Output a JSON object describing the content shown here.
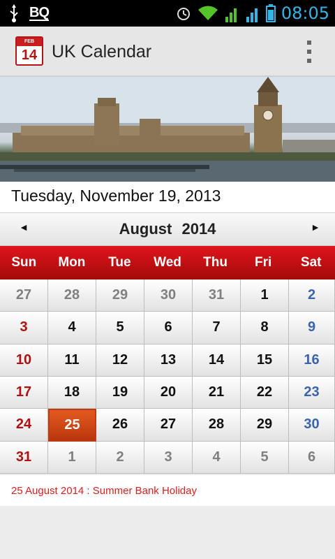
{
  "status_bar": {
    "time": "08:05",
    "left_label": "BQ",
    "icons": [
      "usb-icon",
      "bq-icon",
      "alarm-icon",
      "wifi-icon",
      "signal-1x-icon",
      "signal-r-icon",
      "battery-charging-icon"
    ]
  },
  "action_bar": {
    "title": "UK Calendar",
    "app_icon_month": "FEB",
    "app_icon_day": "14",
    "menu_icon": "overflow-menu-icon"
  },
  "today": {
    "label": "Tuesday, November 19, 2013"
  },
  "month_nav": {
    "month": "August",
    "year": "2014",
    "prev_icon": "◄",
    "next_icon": "►"
  },
  "weekdays": [
    "Sun",
    "Mon",
    "Tue",
    "Wed",
    "Thu",
    "Fri",
    "Sat"
  ],
  "calendar": {
    "rows": [
      [
        {
          "d": "27",
          "t": "other"
        },
        {
          "d": "28",
          "t": "other"
        },
        {
          "d": "29",
          "t": "other"
        },
        {
          "d": "30",
          "t": "other"
        },
        {
          "d": "31",
          "t": "other"
        },
        {
          "d": "1",
          "t": "cur"
        },
        {
          "d": "2",
          "t": "sat"
        }
      ],
      [
        {
          "d": "3",
          "t": "sun"
        },
        {
          "d": "4",
          "t": "cur"
        },
        {
          "d": "5",
          "t": "cur"
        },
        {
          "d": "6",
          "t": "cur"
        },
        {
          "d": "7",
          "t": "cur"
        },
        {
          "d": "8",
          "t": "cur"
        },
        {
          "d": "9",
          "t": "sat"
        }
      ],
      [
        {
          "d": "10",
          "t": "sun"
        },
        {
          "d": "11",
          "t": "cur"
        },
        {
          "d": "12",
          "t": "cur"
        },
        {
          "d": "13",
          "t": "cur"
        },
        {
          "d": "14",
          "t": "cur"
        },
        {
          "d": "15",
          "t": "cur"
        },
        {
          "d": "16",
          "t": "sat"
        }
      ],
      [
        {
          "d": "17",
          "t": "sun"
        },
        {
          "d": "18",
          "t": "cur"
        },
        {
          "d": "19",
          "t": "cur"
        },
        {
          "d": "20",
          "t": "cur"
        },
        {
          "d": "21",
          "t": "cur"
        },
        {
          "d": "22",
          "t": "cur"
        },
        {
          "d": "23",
          "t": "sat"
        }
      ],
      [
        {
          "d": "24",
          "t": "sun"
        },
        {
          "d": "25",
          "t": "sel"
        },
        {
          "d": "26",
          "t": "cur"
        },
        {
          "d": "27",
          "t": "cur"
        },
        {
          "d": "28",
          "t": "cur"
        },
        {
          "d": "29",
          "t": "cur"
        },
        {
          "d": "30",
          "t": "sat"
        }
      ],
      [
        {
          "d": "31",
          "t": "sun"
        },
        {
          "d": "1",
          "t": "other"
        },
        {
          "d": "2",
          "t": "other"
        },
        {
          "d": "3",
          "t": "other"
        },
        {
          "d": "4",
          "t": "other"
        },
        {
          "d": "5",
          "t": "other"
        },
        {
          "d": "6",
          "t": "other"
        }
      ]
    ]
  },
  "holiday": {
    "text": "25 August 2014 : Summer Bank Holiday"
  },
  "colors": {
    "accent_red": "#d21414",
    "saturday_blue": "#3a63b0",
    "sunday_red": "#b01010",
    "selected": "#d24a18",
    "holiday_text": "#e31c1c",
    "time_blue": "#33b5e5"
  }
}
